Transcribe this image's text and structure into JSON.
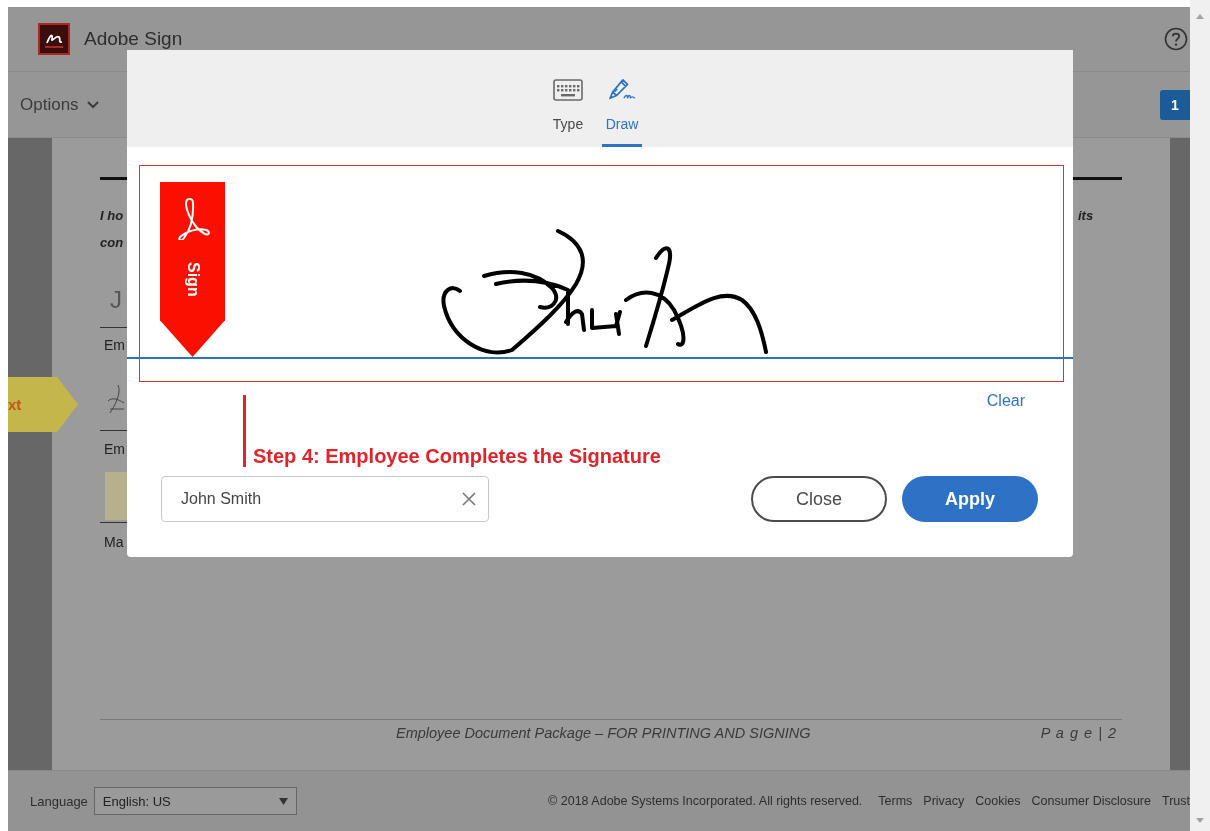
{
  "app": {
    "name": "Adobe Sign"
  },
  "toolbar": {
    "options_label": "Options",
    "page_badge": "1"
  },
  "document": {
    "left_fragments": [
      "I ho",
      "con",
      "J",
      "Em",
      "Em",
      "Ma"
    ],
    "right_fragment": "its",
    "next_flag": "xt",
    "footer_text": "Employee Document Package – FOR PRINTING AND SIGNING",
    "page_label": "P a g e | 2"
  },
  "dialog": {
    "tabs": [
      {
        "label": "Type",
        "kind": "keyboard",
        "selected": false
      },
      {
        "label": "Draw",
        "kind": "pen",
        "selected": true
      }
    ],
    "badge_label": "Sign",
    "clear_label": "Clear",
    "annotation": "Step 4: Employee Completes the Signature",
    "name_value": "John Smith",
    "buttons": [
      {
        "label": "Close",
        "kind": "secondary"
      },
      {
        "label": "Apply",
        "kind": "primary"
      }
    ]
  },
  "footer": {
    "language_label": "Language",
    "language_value": "English: US",
    "copyright": "© 2018 Adobe Systems Incorporated. All rights reserved.",
    "links": [
      "Terms",
      "Privacy",
      "Cookies",
      "Consumer Disclosure",
      "Trust"
    ]
  }
}
